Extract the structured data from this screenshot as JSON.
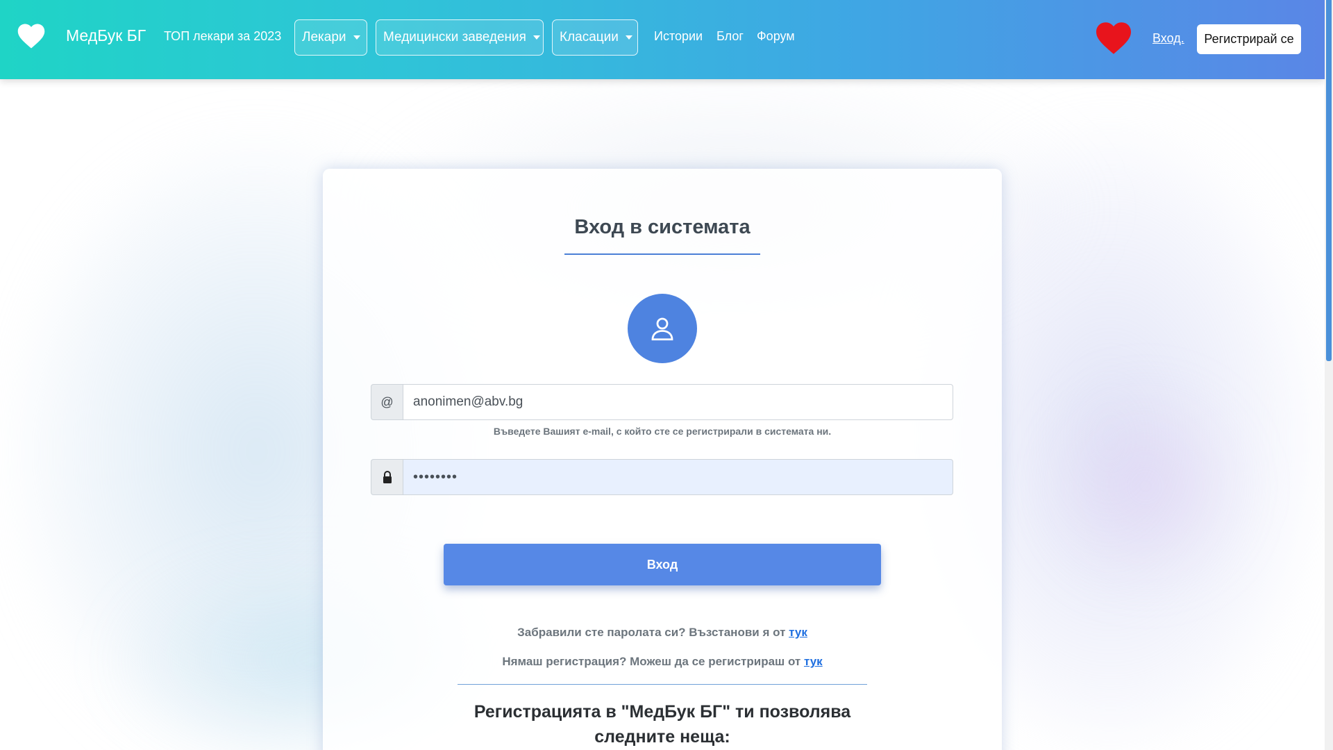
{
  "navbar": {
    "brand": "МедБук БГ",
    "top_doctors": "ТОП лекари за 2023",
    "dropdowns": [
      {
        "label": "Лекари"
      },
      {
        "label": "Медицински заведения"
      },
      {
        "label": "Класации"
      }
    ],
    "links": [
      "Истории",
      "Блог",
      "Форум"
    ],
    "login": "Вход.",
    "register": "Регистрирай се"
  },
  "login_card": {
    "title": "Вход в системата",
    "email_addon": "@",
    "email_value": "anonimen@abv.bg",
    "email_help": "Въведете Вашият e-mail, с който сте се регистрирали в системата ни.",
    "password_value": "••••••••",
    "submit": "Вход",
    "forgot_text": "Забравили сте паролата си? Възстанови я от",
    "forgot_link": "тук",
    "no_account_text": "Нямаш регистрация? Можеш да се регистрираш от",
    "no_account_link": "тук",
    "benefits_title": "Регистрацията в \"МедБук БГ\" ти позволява следните неща:"
  },
  "colors": {
    "navbar_start": "#1fd4c6",
    "navbar_end": "#5a86e6",
    "accent": "#5688e6",
    "link": "#1f6fe0",
    "heart": "#e8141c"
  },
  "icons": [
    "heart-icon",
    "user-icon",
    "lock-icon",
    "caret-down-icon"
  ]
}
